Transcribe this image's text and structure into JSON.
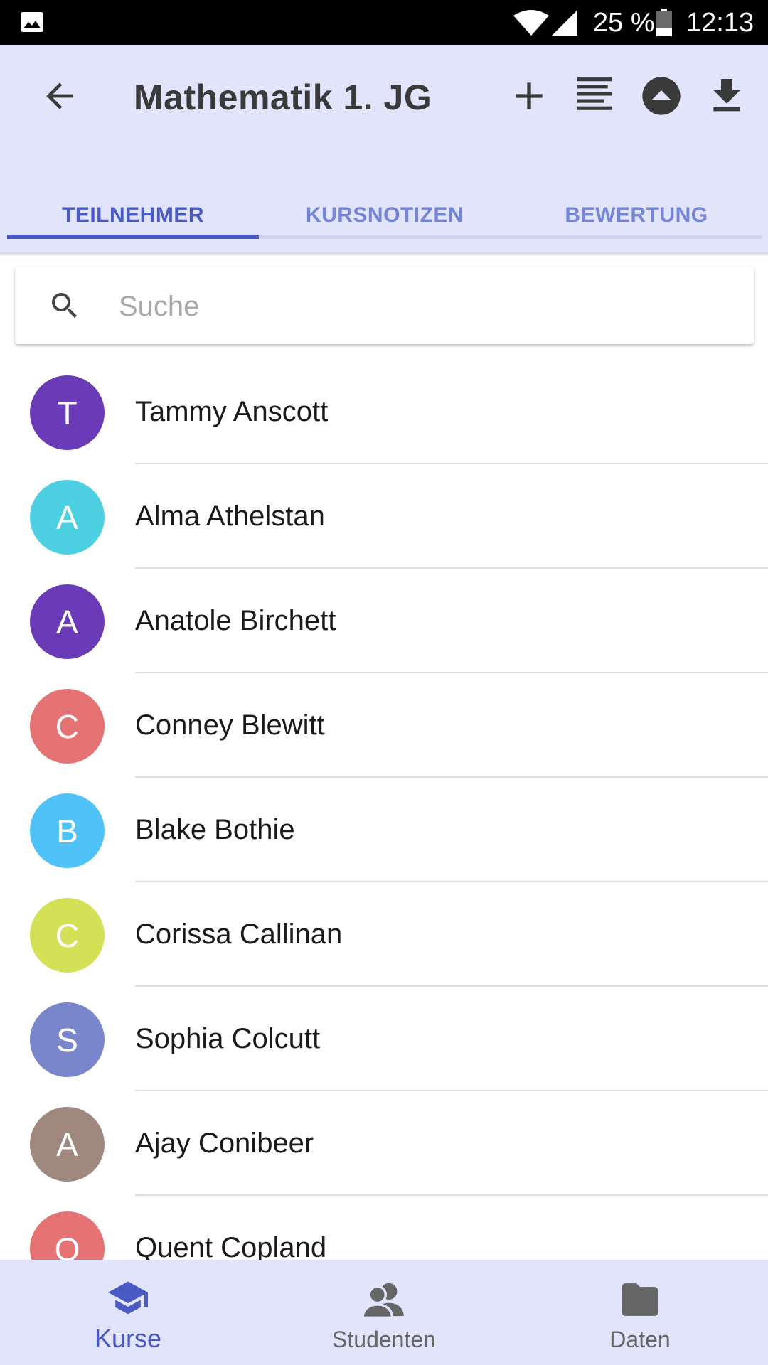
{
  "status_bar": {
    "battery": "25 %",
    "time": "12:13"
  },
  "app_bar": {
    "title": "Mathematik 1. JG"
  },
  "tabs": [
    {
      "label": "TEILNEHMER",
      "active": true
    },
    {
      "label": "KURSNOTIZEN",
      "active": false
    },
    {
      "label": "BEWERTUNG",
      "active": false
    }
  ],
  "search": {
    "placeholder": "Suche",
    "value": ""
  },
  "participants": [
    {
      "initial": "T",
      "name": "Tammy Anscott",
      "color": "#6a3ab8"
    },
    {
      "initial": "A",
      "name": "Alma Athelstan",
      "color": "#4dd0e1"
    },
    {
      "initial": "A",
      "name": "Anatole Birchett",
      "color": "#6a3ab8"
    },
    {
      "initial": "C",
      "name": "Conney Blewitt",
      "color": "#e57373"
    },
    {
      "initial": "B",
      "name": "Blake Bothie",
      "color": "#4fc3f7"
    },
    {
      "initial": "C",
      "name": "Corissa Callinan",
      "color": "#d4e157"
    },
    {
      "initial": "S",
      "name": "Sophia Colcutt",
      "color": "#7986cb"
    },
    {
      "initial": "A",
      "name": "Ajay Conibeer",
      "color": "#a1887f"
    },
    {
      "initial": "Q",
      "name": "Quent Copland",
      "color": "#e57373"
    }
  ],
  "bottom_nav": [
    {
      "label": "Kurse",
      "icon": "school-icon",
      "active": true
    },
    {
      "label": "Studenten",
      "icon": "people-icon",
      "active": false
    },
    {
      "label": "Daten",
      "icon": "folder-icon",
      "active": false
    }
  ],
  "colors": {
    "accent": "#4a5ac4",
    "app_bar_bg": "#e1e4fb"
  }
}
